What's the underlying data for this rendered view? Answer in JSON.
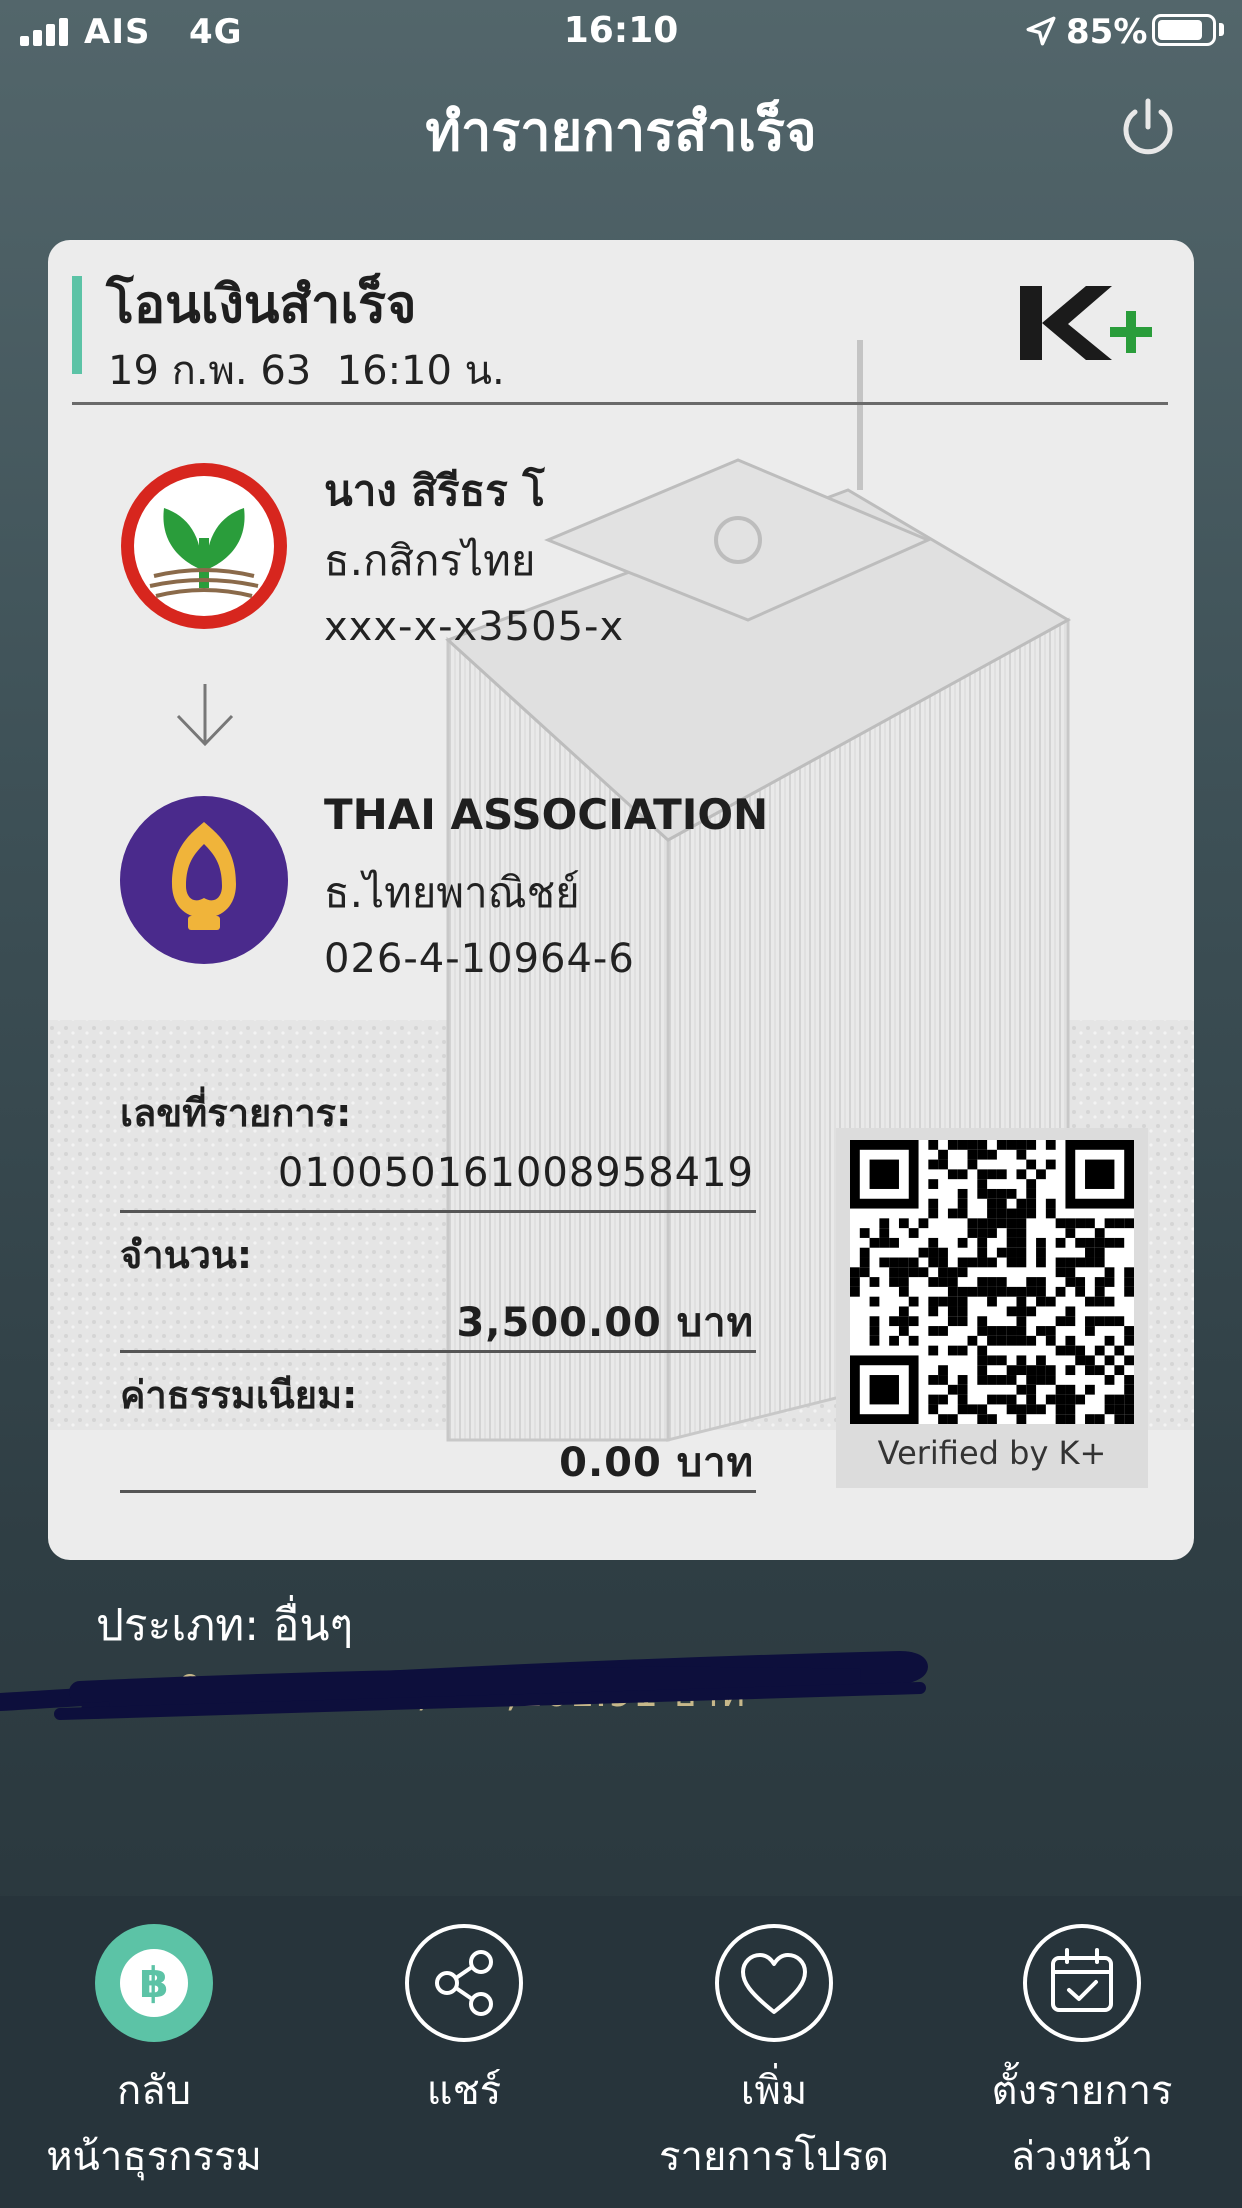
{
  "status_bar": {
    "carrier": "AIS   4G",
    "time": "16:10",
    "battery": "85%",
    "battery_level": 0.85,
    "icons": [
      "signal-icon",
      "location-arrow-icon",
      "battery-icon"
    ]
  },
  "header": {
    "title": "ทำรายการสำเร็จ",
    "power_icon": "power-icon"
  },
  "receipt": {
    "title": "โอนเงินสำเร็จ",
    "datetime": "19 ก.พ. 63  16:10 น.",
    "brand_logo": "K+",
    "sender": {
      "name": "นาง สิรีธร โ",
      "bank": "ธ.กสิกรไทย",
      "account": "xxx-x-x3505-x",
      "logo": "kasikorn-bank-logo"
    },
    "receiver": {
      "name": "THAI ASSOCIATION",
      "bank": "ธ.ไทยพาณิชย์",
      "account": "026-4-10964-6",
      "logo": "scb-bank-logo"
    },
    "transaction_id_label": "เลขที่รายการ:",
    "transaction_id": "010050161008958419",
    "amount_label": "จำนวน:",
    "amount": "3,500.00 บาท",
    "fee_label": "ค่าธรรมเนียม:",
    "fee": "0.00 บาท",
    "qr_caption": "Verified by K+"
  },
  "extra": {
    "type_line": "ประเภท: อื่นๆ",
    "balance_line": "ยอดเงินคงเหลือ: 2,222,201.91 บาท"
  },
  "bottom_nav": [
    {
      "label1": "กลับ",
      "label2": "หน้าธุรกรรม",
      "icon": "baht-icon",
      "active": true
    },
    {
      "label1": "แชร์",
      "label2": "",
      "icon": "share-icon",
      "active": false
    },
    {
      "label1": "เพิ่ม",
      "label2": "รายการโปรด",
      "icon": "heart-icon",
      "active": false
    },
    {
      "label1": "ตั้งรายการ",
      "label2": "ล่วงหน้า",
      "icon": "calendar-check-icon",
      "active": false
    }
  ],
  "colors": {
    "accent": "#5cc3a6",
    "background_top": "#53666b",
    "background_bottom": "#27343a",
    "card": "#ececec",
    "kbank_red": "#d7261e",
    "kbank_green": "#2a9d3b",
    "scb_purple": "#4a2a8c",
    "scb_gold": "#f0b43a"
  }
}
